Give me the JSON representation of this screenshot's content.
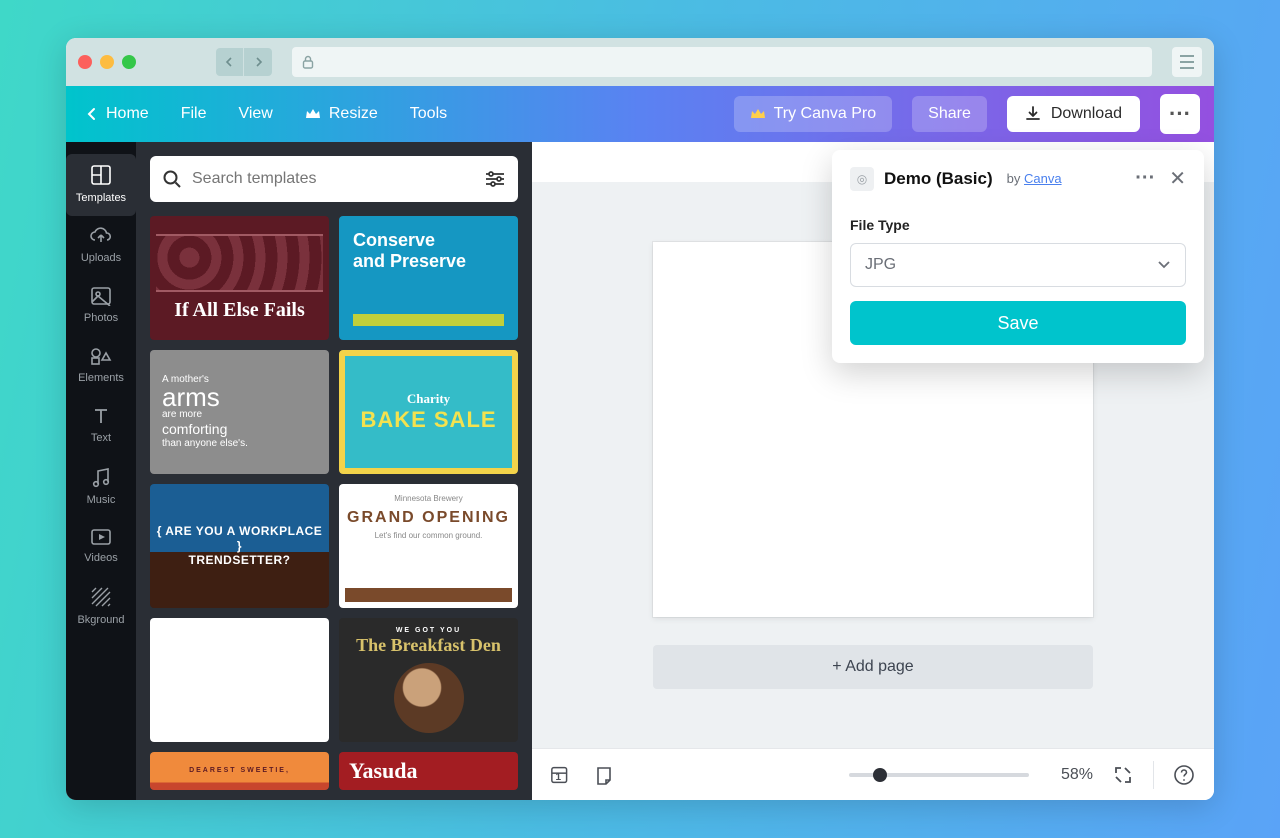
{
  "appbar": {
    "home": "Home",
    "file": "File",
    "view": "View",
    "resize": "Resize",
    "tools": "Tools",
    "try_pro": "Try Canva Pro",
    "share": "Share",
    "download": "Download"
  },
  "rail": {
    "templates": "Templates",
    "uploads": "Uploads",
    "photos": "Photos",
    "elements": "Elements",
    "text": "Text",
    "music": "Music",
    "videos": "Videos",
    "background": "Bkground"
  },
  "search": {
    "placeholder": "Search templates"
  },
  "templates": {
    "t1_line": "If All Else Fails",
    "t2_line1": "Conserve",
    "t2_line2": "and Preserve",
    "t3_s1": "A mother's",
    "t3_b": "arms",
    "t3_s2": "are more",
    "t3_s3": "comforting",
    "t3_s4": "than anyone else's.",
    "t4_c": "Charity",
    "t4_b": "BAKE SALE",
    "t5_l1": "ARE YOU A WORKPLACE",
    "t5_l2": "TRENDSETTER?",
    "t6_small": "Minnesota Brewery",
    "t6_big": "GRAND OPENING",
    "t6_sub": "Let's find our common ground.",
    "t8_top": "WE GOT YOU",
    "t8_scr": "The Breakfast Den",
    "t9_small": "DEAREST SWEETIE,",
    "t10_scr": "Yasuda"
  },
  "popover": {
    "title": "Demo (Basic)",
    "by": "by",
    "vendor": "Canva",
    "file_type_label": "File Type",
    "file_type_value": "JPG",
    "save": "Save"
  },
  "canvas": {
    "add_page": "+ Add page"
  },
  "status": {
    "page_count": "1",
    "zoom_value": "58%",
    "zoom_pct": 17
  }
}
